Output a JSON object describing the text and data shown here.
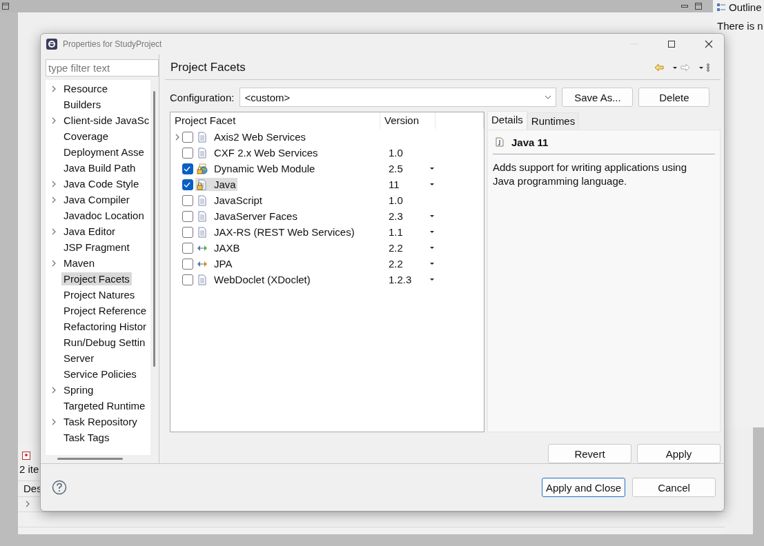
{
  "background": {
    "outline_tab": "Outline",
    "outline_message": "There is n",
    "markers_count": "2 ite",
    "markers_column": "Des"
  },
  "dialog": {
    "title": "Properties for StudyProject",
    "filter": {
      "placeholder": "type filter text"
    },
    "nav": [
      {
        "label": "Resource",
        "expandable": true,
        "selected": false
      },
      {
        "label": "Builders",
        "expandable": false,
        "selected": false
      },
      {
        "label": "Client-side JavaSc",
        "expandable": true,
        "selected": false
      },
      {
        "label": "Coverage",
        "expandable": false,
        "selected": false
      },
      {
        "label": "Deployment Asse",
        "expandable": false,
        "selected": false
      },
      {
        "label": "Java Build Path",
        "expandable": false,
        "selected": false
      },
      {
        "label": "Java Code Style",
        "expandable": true,
        "selected": false
      },
      {
        "label": "Java Compiler",
        "expandable": true,
        "selected": false
      },
      {
        "label": "Javadoc Location",
        "expandable": false,
        "selected": false
      },
      {
        "label": "Java Editor",
        "expandable": true,
        "selected": false
      },
      {
        "label": "JSP Fragment",
        "expandable": false,
        "selected": false
      },
      {
        "label": "Maven",
        "expandable": true,
        "selected": false
      },
      {
        "label": "Project Facets",
        "expandable": false,
        "selected": true
      },
      {
        "label": "Project Natures",
        "expandable": false,
        "selected": false
      },
      {
        "label": "Project Reference",
        "expandable": false,
        "selected": false
      },
      {
        "label": "Refactoring Histor",
        "expandable": false,
        "selected": false
      },
      {
        "label": "Run/Debug Settin",
        "expandable": false,
        "selected": false
      },
      {
        "label": "Server",
        "expandable": false,
        "selected": false
      },
      {
        "label": "Service Policies",
        "expandable": false,
        "selected": false
      },
      {
        "label": "Spring",
        "expandable": true,
        "selected": false
      },
      {
        "label": "Targeted Runtime",
        "expandable": false,
        "selected": false
      },
      {
        "label": "Task Repository",
        "expandable": true,
        "selected": false
      },
      {
        "label": "Task Tags",
        "expandable": false,
        "selected": false
      }
    ],
    "page_title": "Project Facets",
    "configuration": {
      "label": "Configuration:",
      "value": "<custom>"
    },
    "config_buttons": [
      "Save As...",
      "Delete"
    ],
    "facets": {
      "columns": [
        "Project Facet",
        "Version"
      ],
      "rows": [
        {
          "name": "Axis2 Web Services",
          "expandable": true,
          "checked": false,
          "locked": false,
          "kind": "document",
          "selected": false
        },
        {
          "name": "CXF 2.x Web Services",
          "version": "1.0",
          "expandable": false,
          "checked": false,
          "locked": false,
          "kind": "document",
          "has_menu": false,
          "selected": false
        },
        {
          "name": "Dynamic Web Module",
          "version": "2.5",
          "expandable": false,
          "checked": true,
          "locked": true,
          "kind": "web",
          "has_menu": true,
          "selected": false
        },
        {
          "name": "Java",
          "version": "11",
          "expandable": false,
          "checked": true,
          "locked": true,
          "kind": "document",
          "has_menu": true,
          "selected": true
        },
        {
          "name": "JavaScript",
          "version": "1.0",
          "expandable": false,
          "checked": false,
          "locked": false,
          "kind": "document",
          "has_menu": false,
          "selected": false
        },
        {
          "name": "JavaServer Faces",
          "version": "2.3",
          "expandable": false,
          "checked": false,
          "locked": false,
          "kind": "document",
          "has_menu": true,
          "selected": false
        },
        {
          "name": "JAX-RS (REST Web Services)",
          "version": "1.1",
          "expandable": false,
          "checked": false,
          "locked": false,
          "kind": "document",
          "has_menu": true,
          "selected": false
        },
        {
          "name": "JAXB",
          "version": "2.2",
          "expandable": false,
          "checked": false,
          "locked": false,
          "kind": "binding",
          "has_menu": true,
          "selected": false
        },
        {
          "name": "JPA",
          "version": "2.2",
          "expandable": false,
          "checked": false,
          "locked": false,
          "kind": "persistence",
          "has_menu": true,
          "selected": false
        },
        {
          "name": "WebDoclet (XDoclet)",
          "version": "1.2.3",
          "expandable": false,
          "checked": false,
          "locked": false,
          "kind": "document",
          "has_menu": true,
          "selected": false
        }
      ]
    },
    "details": {
      "tabs": [
        {
          "label": "Details",
          "selected": true
        },
        {
          "label": "Runtimes",
          "selected": false
        }
      ],
      "title": "Java 11",
      "description": "Adds support for writing applications using Java programming language."
    },
    "page_buttons": [
      "Revert",
      "Apply"
    ],
    "buttons": [
      {
        "label": "Apply and Close",
        "default": true
      },
      {
        "label": "Cancel",
        "default": false
      }
    ]
  }
}
